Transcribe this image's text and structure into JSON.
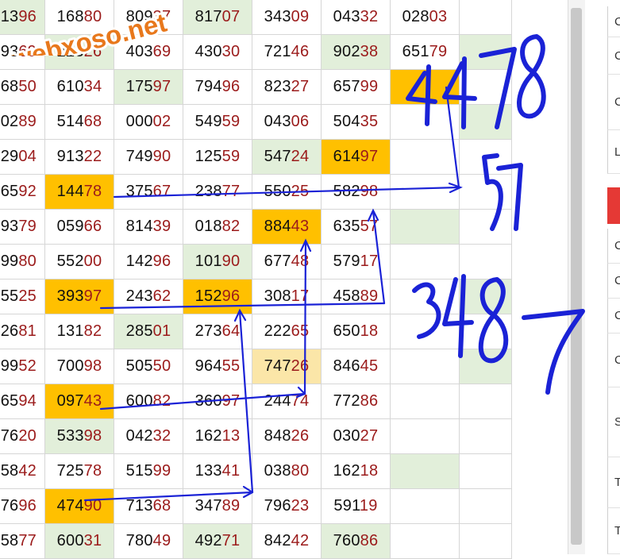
{
  "watermark": {
    "text": "webxoso.net"
  },
  "table": {
    "rows": [
      [
        "1396",
        "16880",
        "80937",
        "81707",
        "34309",
        "04332",
        "02803",
        ""
      ],
      [
        "9369",
        "22326",
        "40369",
        "43030",
        "72146",
        "90238",
        "65179",
        ""
      ],
      [
        "6850",
        "61034",
        "17597",
        "79496",
        "82327",
        "65799",
        "",
        ""
      ],
      [
        "0289",
        "51468",
        "00002",
        "54959",
        "04306",
        "50435",
        "",
        ""
      ],
      [
        "2904",
        "91322",
        "74990",
        "12559",
        "54724",
        "61497",
        "",
        ""
      ],
      [
        "6592",
        "14478",
        "37567",
        "23877",
        "55025",
        "58298",
        "",
        ""
      ],
      [
        "9379",
        "05966",
        "81439",
        "01882",
        "88443",
        "63557",
        "",
        ""
      ],
      [
        "9980",
        "55200",
        "14296",
        "10190",
        "67748",
        "57917",
        "",
        ""
      ],
      [
        "5525",
        "39397",
        "24362",
        "15296",
        "30817",
        "45889",
        "",
        ""
      ],
      [
        "2681",
        "13182",
        "28501",
        "27364",
        "22265",
        "65018",
        "",
        ""
      ],
      [
        "9952",
        "70098",
        "50550",
        "96455",
        "74726",
        "84645",
        "",
        ""
      ],
      [
        "6594",
        "09743",
        "60082",
        "36097",
        "24474",
        "77286",
        "",
        ""
      ],
      [
        "7620",
        "53398",
        "04232",
        "16213",
        "84826",
        "03027",
        "",
        ""
      ],
      [
        "5842",
        "72578",
        "51599",
        "13341",
        "03880",
        "16218",
        "",
        ""
      ],
      [
        "7696",
        "47490",
        "71368",
        "34789",
        "79623",
        "59119",
        "",
        ""
      ],
      [
        "5877",
        "60031",
        "78049",
        "49271",
        "84242",
        "76086",
        "",
        ""
      ]
    ],
    "highlights": [
      {
        "r": 0,
        "c": 0,
        "s": "green"
      },
      {
        "r": 0,
        "c": 3,
        "s": "green"
      },
      {
        "r": 1,
        "c": 1,
        "s": "green"
      },
      {
        "r": 1,
        "c": 5,
        "s": "green"
      },
      {
        "r": 1,
        "c": 7,
        "s": "green"
      },
      {
        "r": 2,
        "c": 2,
        "s": "green"
      },
      {
        "r": 2,
        "c": 6,
        "s": "orange"
      },
      {
        "r": 3,
        "c": 7,
        "s": "green"
      },
      {
        "r": 4,
        "c": 4,
        "s": "green"
      },
      {
        "r": 4,
        "c": 5,
        "s": "orange"
      },
      {
        "r": 5,
        "c": 1,
        "s": "orange"
      },
      {
        "r": 6,
        "c": 4,
        "s": "orange"
      },
      {
        "r": 6,
        "c": 6,
        "s": "green"
      },
      {
        "r": 7,
        "c": 3,
        "s": "green"
      },
      {
        "r": 8,
        "c": 1,
        "s": "orange"
      },
      {
        "r": 8,
        "c": 3,
        "s": "orange"
      },
      {
        "r": 8,
        "c": 7,
        "s": "green"
      },
      {
        "r": 9,
        "c": 2,
        "s": "green"
      },
      {
        "r": 10,
        "c": 4,
        "s": "light"
      },
      {
        "r": 10,
        "c": 7,
        "s": "green"
      },
      {
        "r": 11,
        "c": 1,
        "s": "orange"
      },
      {
        "r": 12,
        "c": 1,
        "s": "green"
      },
      {
        "r": 13,
        "c": 6,
        "s": "green"
      },
      {
        "r": 14,
        "c": 1,
        "s": "orange"
      },
      {
        "r": 15,
        "c": 1,
        "s": "green"
      },
      {
        "r": 15,
        "c": 3,
        "s": "green"
      },
      {
        "r": 15,
        "c": 5,
        "s": "green"
      }
    ]
  },
  "sidebar": {
    "items": [
      {
        "label": "C"
      },
      {
        "label": "C"
      },
      {
        "label": "C V"
      },
      {
        "label": "L"
      },
      {
        "label": "C"
      },
      {
        "label": "C"
      },
      {
        "label": "C"
      },
      {
        "label": "C"
      },
      {
        "label": "S"
      },
      {
        "label": "T"
      },
      {
        "label": "T"
      }
    ]
  },
  "colors": {
    "orange": "#ffc000",
    "light_orange": "#fbe6a8",
    "green": "#e2efda",
    "number_dark": "#111111",
    "number_red": "#9b1b1b",
    "annotation_blue": "#1a22d6",
    "watermark": "#e8781c",
    "sidebar_red": "#e53935"
  },
  "annotations": {
    "handwritten_numbers": [
      "4478",
      "57",
      "3487"
    ],
    "arrows": [
      {
        "from": "14478",
        "to": "4478"
      },
      {
        "from": "39397",
        "to": "45889"
      },
      {
        "from": "09743",
        "to": "88443"
      },
      {
        "from": "47490",
        "to": "15296"
      }
    ]
  }
}
